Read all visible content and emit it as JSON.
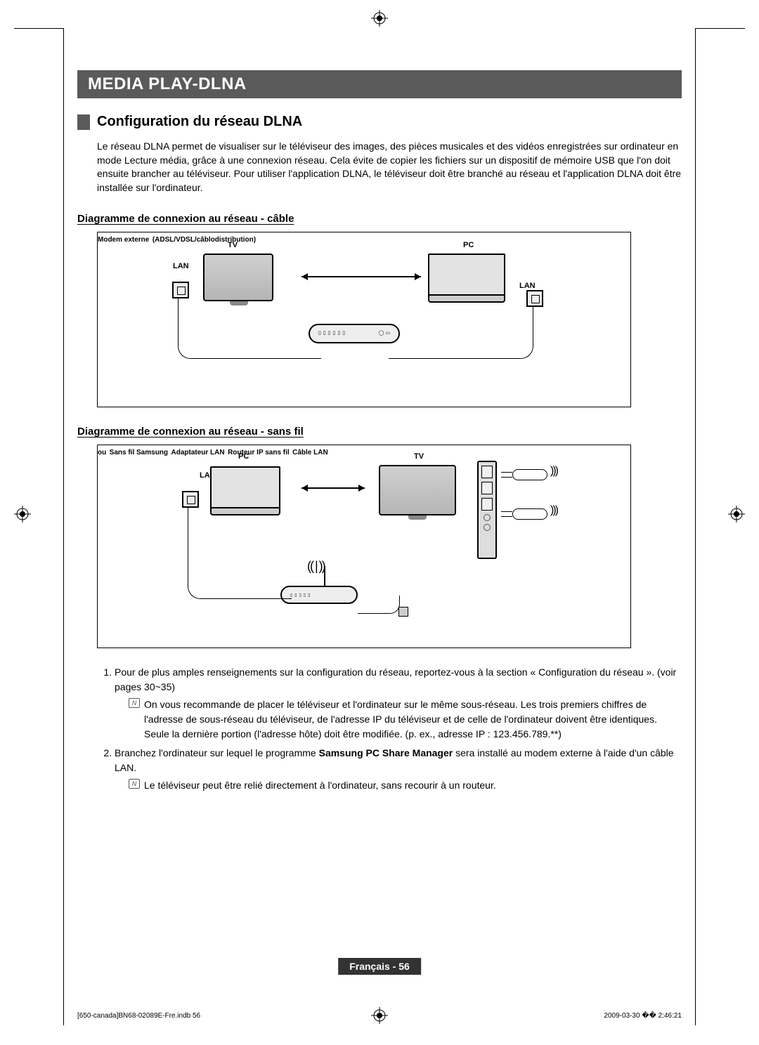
{
  "banner": "MEDIA PLAY-DLNA",
  "section_title": "Configuration du réseau DLNA",
  "intro": "Le réseau DLNA permet de visualiser sur le téléviseur des images, des pièces musicales et des vidéos enregistrées sur ordinateur en mode Lecture média, grâce à une connexion réseau. Cela évite de copier les fichiers sur un dispositif de mémoire USB que l'on doit ensuite brancher au téléviseur. Pour utiliser l'application DLNA, le téléviseur doit être branché au réseau et l'application DLNA doit être installée sur l'ordinateur.",
  "subheading1": "Diagramme de connexion au réseau - câble",
  "subheading2": "Diagramme de connexion au réseau - sans fil",
  "diagram1": {
    "tv": "TV",
    "pc": "PC",
    "lan1": "LAN",
    "lan2": "LAN",
    "modem_line1": "Modem externe",
    "modem_line2": "(ADSL/VDSL/câblodistribution)"
  },
  "diagram2": {
    "pc": "PC",
    "tv": "TV",
    "lan": "LAN",
    "ou": "ou",
    "adapter_line1": "Sans fil Samsung",
    "adapter_line2": "Adaptateur LAN",
    "router": "Routeur IP sans fil",
    "cable": "Câble LAN"
  },
  "notes": {
    "n1": "Pour de plus amples renseignements sur la configuration du réseau, reportez-vous à la section « Configuration du réseau ». (voir pages 30~35)",
    "n1_sub": "On vous recommande de placer le téléviseur et l'ordinateur sur le même sous-réseau. Les trois premiers chiffres de l'adresse de sous-réseau du téléviseur, de l'adresse IP du téléviseur et de celle de l'ordinateur doivent être identiques. Seule la dernière portion (l'adresse hôte) doit être modifiée. (p. ex., adresse IP : 123.456.789.**)",
    "n2_a": "Branchez l'ordinateur sur lequel le programme ",
    "n2_b": "Samsung PC Share Manager",
    "n2_c": " sera installé au modem externe à l'aide d'un câble LAN.",
    "n2_sub": "Le téléviseur peut être relié directement à l'ordinateur, sans recourir à un routeur."
  },
  "footer": "Français - 56",
  "imprint_left": "[650-canada]BN68-02089E-Fre.indb   56",
  "imprint_right": "2009-03-30   �� 2:46:21"
}
